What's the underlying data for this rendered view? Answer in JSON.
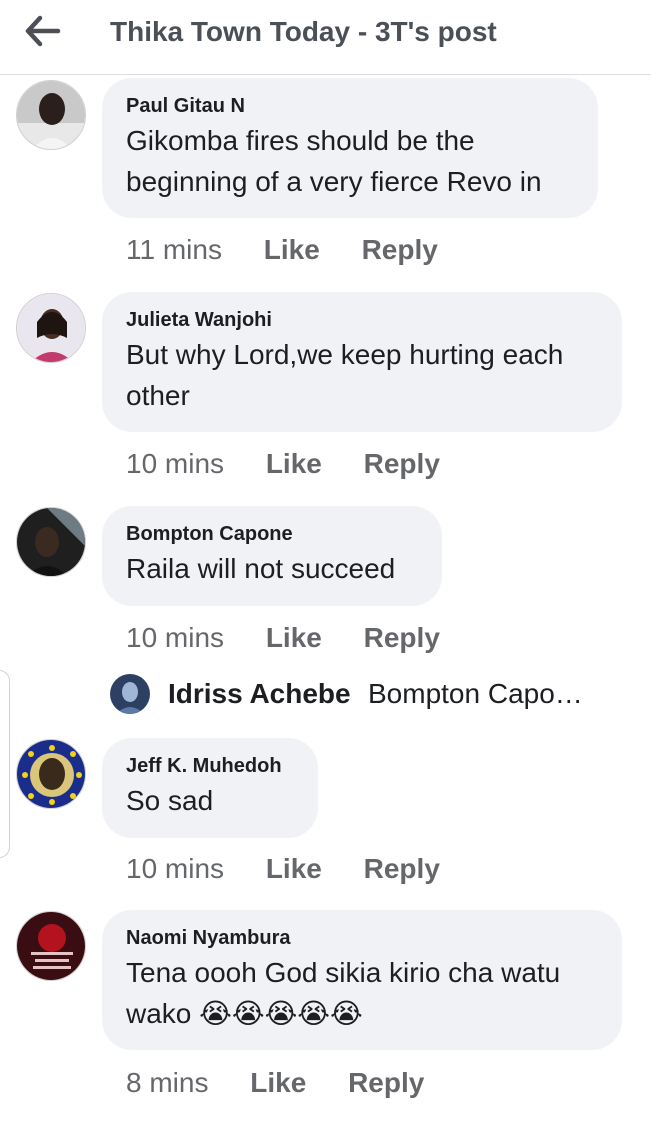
{
  "header": {
    "title": "Thika Town Today - 3T's post",
    "back_icon": "back-arrow-icon"
  },
  "comments": [
    {
      "author": "Paul Gitau N",
      "text": "Gikomba fires should be the beginning of a very fierce Revo in",
      "time": "11 mins",
      "like": "Like",
      "reply": "Reply"
    },
    {
      "author": "Julieta Wanjohi",
      "text": "But why Lord,we keep hurting each other",
      "time": "10 mins",
      "like": "Like",
      "reply": "Reply"
    },
    {
      "author": "Bompton Capone",
      "text": "Raila will not succeed",
      "time": "10 mins",
      "like": "Like",
      "reply": "Reply"
    },
    {
      "author": "Jeff K. Muhedoh",
      "text": "So sad",
      "time": "10 mins",
      "like": "Like",
      "reply": "Reply"
    },
    {
      "author": "Naomi Nyambura",
      "text": "Tena oooh God sikia kirio cha watu wako 😭😭😭😭😭",
      "time": "8 mins",
      "like": "Like",
      "reply": "Reply"
    }
  ],
  "reply_preview": {
    "author": "Idriss Achebe",
    "text": "Bompton Capo…"
  },
  "colors": {
    "bubble": "#f0f2f5",
    "meta": "#65676b",
    "title": "#4b4f56"
  }
}
